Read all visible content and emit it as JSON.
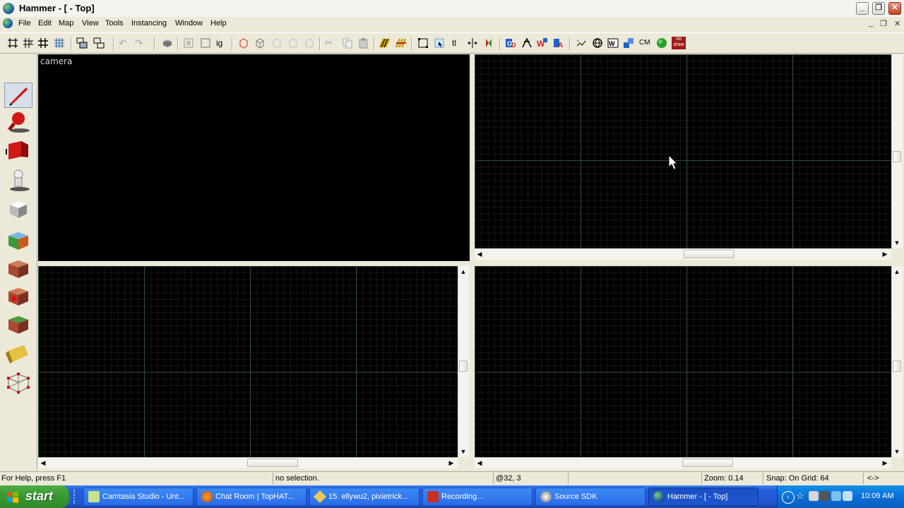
{
  "window": {
    "title": "Hammer - [ - Top]",
    "buttons": {
      "minimize": "_",
      "restore": "❐",
      "close": "✕"
    }
  },
  "menu": {
    "items": [
      "File",
      "Edit",
      "Map",
      "View",
      "Tools",
      "Instancing",
      "Window",
      "Help"
    ],
    "mdi_buttons": {
      "minimize": "_",
      "restore": "❐",
      "close": "✕"
    }
  },
  "toolbar": {
    "text_buttons": {
      "ig": "ig",
      "tl": "tl",
      "cm": "CM",
      "nodraw": "no draw"
    }
  },
  "palette": {
    "tools": [
      "selection-tool",
      "magnify-tool",
      "camera-tool",
      "entity-tool",
      "block-tool",
      "texture-application-tool",
      "apply-current-texture-tool",
      "decal-tool",
      "overlay-tool",
      "clipping-tool",
      "vertex-manipulation-tool"
    ]
  },
  "viewports": {
    "camera_label": "camera"
  },
  "statusbar": {
    "help": "For Help, press F1",
    "selection": "no selection.",
    "coords": "@32, 3",
    "zoom": "Zoom: 0.14",
    "snap": "Snap: On Grid: 64",
    "misc": "<->"
  },
  "taskbar": {
    "start_label": "start",
    "tasks": [
      {
        "label": "Camtasia Studio - Unt...",
        "icon": "camtasia-icon",
        "color": "#c8e08a"
      },
      {
        "label": "Chat Room | TopHAT...",
        "icon": "firefox-icon",
        "color": "#e8731e"
      },
      {
        "label": "15. ellywu2, pixietrick...",
        "icon": "pencil-icon",
        "color": "#e8c85a"
      },
      {
        "label": "Recording...",
        "icon": "recording-icon",
        "color": "#c83020"
      },
      {
        "label": "Source SDK",
        "icon": "steam-icon",
        "color": "#d0d0d0"
      },
      {
        "label": "Hammer - [ - Top]",
        "icon": "hammer-icon",
        "color": "#4aa8e0"
      }
    ],
    "clock": "10:09 AM"
  }
}
